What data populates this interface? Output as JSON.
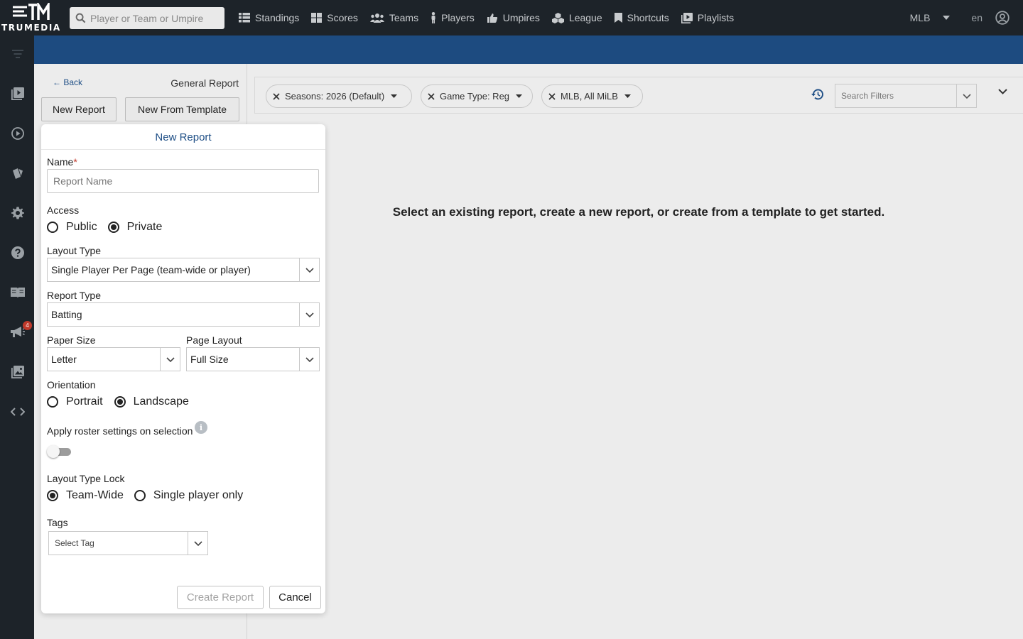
{
  "app": {
    "logo_text": "TRUMEDIA"
  },
  "topnav": {
    "search_placeholder": "Player or Team or Umpire",
    "items": [
      {
        "label": "Standings",
        "icon": "table-icon"
      },
      {
        "label": "Scores",
        "icon": "grid-icon"
      },
      {
        "label": "Teams",
        "icon": "users-icon"
      },
      {
        "label": "Players",
        "icon": "person-icon"
      },
      {
        "label": "Umpires",
        "icon": "thumbs-up-icon"
      },
      {
        "label": "League",
        "icon": "cubes-icon"
      },
      {
        "label": "Shortcuts",
        "icon": "bookmark-icon"
      },
      {
        "label": "Playlists",
        "icon": "playlist-icon"
      }
    ],
    "league_selected": "MLB",
    "language": "en"
  },
  "sidebar": {
    "icons": [
      "filter-lines-icon",
      "video-library-icon",
      "play-circle-icon",
      "cards-icon",
      "gear-icon",
      "help-icon",
      "book-icon",
      "megaphone-icon",
      "images-icon",
      "code-icon"
    ],
    "notification_count": "4"
  },
  "report_panel": {
    "back_label": "← Back",
    "report_kind": "General Report",
    "new_report_label": "New Report",
    "new_from_template_label": "New From Template"
  },
  "filters": {
    "chips": [
      {
        "label": "Seasons: 2026 (Default)"
      },
      {
        "label": "Game Type: Reg"
      },
      {
        "label": "MLB, All MiLB"
      }
    ],
    "search_placeholder": "Search Filters"
  },
  "main": {
    "empty_message": "Select an existing report, create a new report, or create from a template to get started."
  },
  "modal": {
    "title": "New Report",
    "name_label": "Name",
    "name_required_mark": "*",
    "name_placeholder": "Report Name",
    "access_label": "Access",
    "access_options": [
      "Public",
      "Private"
    ],
    "access_selected": "Private",
    "layout_type_label": "Layout Type",
    "layout_type_value": "Single Player Per Page (team-wide or player)",
    "report_type_label": "Report Type",
    "report_type_value": "Batting",
    "paper_size_label": "Paper Size",
    "paper_size_value": "Letter",
    "page_layout_label": "Page Layout",
    "page_layout_value": "Full Size",
    "orientation_label": "Orientation",
    "orientation_options": [
      "Portrait",
      "Landscape"
    ],
    "orientation_selected": "Landscape",
    "roster_label": "Apply roster settings on selection",
    "roster_enabled": false,
    "info_glyph": "i",
    "lock_label": "Layout Type Lock",
    "lock_options": [
      "Team-Wide",
      "Single player only"
    ],
    "lock_selected": "Team-Wide",
    "tags_label": "Tags",
    "tags_placeholder": "Select Tag",
    "create_label": "Create Report",
    "cancel_label": "Cancel"
  },
  "colors": {
    "nav_bg": "#1d2329",
    "accent_blue": "#1d4b80",
    "link_blue": "#1f4f86",
    "badge_red": "#c0392b"
  }
}
